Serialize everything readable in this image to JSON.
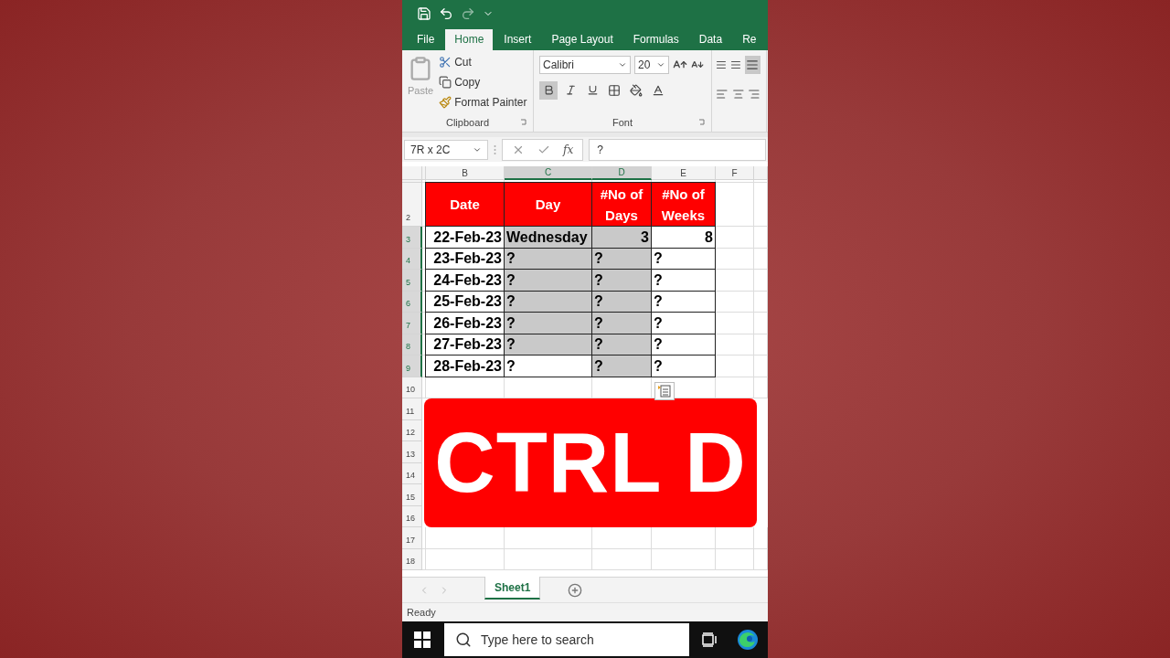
{
  "ribbon_tabs": [
    {
      "label": "File",
      "selected": false
    },
    {
      "label": "Home",
      "selected": true
    },
    {
      "label": "Insert",
      "selected": false
    },
    {
      "label": "Page Layout",
      "selected": false
    },
    {
      "label": "Formulas",
      "selected": false
    },
    {
      "label": "Data",
      "selected": false
    },
    {
      "label": "Re",
      "selected": false
    }
  ],
  "clipboard": {
    "paste": "Paste",
    "cut": "Cut",
    "copy": "Copy",
    "format_painter": "Format Painter",
    "group_label": "Clipboard"
  },
  "font": {
    "name": "Calibri",
    "size": "20",
    "bold": true,
    "italic": false,
    "underline": false,
    "group_label": "Font"
  },
  "formula_bar": {
    "name_box": "7R x 2C",
    "function_label": "fx",
    "value": "?"
  },
  "columns": [
    {
      "label": "B",
      "selected": false
    },
    {
      "label": "C",
      "selected": true
    },
    {
      "label": "D",
      "selected": true
    },
    {
      "label": "E",
      "selected": false
    },
    {
      "label": "F",
      "selected": false
    }
  ],
  "header_row": {
    "row": "2",
    "cells": [
      "Date",
      "Day",
      "#No of Days",
      "#No of Weeks"
    ]
  },
  "rows": [
    {
      "row": "3",
      "selected": true,
      "cells": [
        {
          "text": "22-Feb-23",
          "kind": "date",
          "selected": false
        },
        {
          "text": "Wednesday",
          "kind": "text",
          "selected": true
        },
        {
          "text": "3",
          "kind": "number",
          "selected": true
        },
        {
          "text": "8",
          "kind": "number",
          "selected": false
        }
      ]
    },
    {
      "row": "4",
      "selected": true,
      "cells": [
        {
          "text": "23-Feb-23",
          "kind": "date",
          "selected": false
        },
        {
          "text": "?",
          "kind": "text",
          "selected": true
        },
        {
          "text": "?",
          "kind": "text",
          "selected": true
        },
        {
          "text": "?",
          "kind": "text",
          "selected": false
        }
      ]
    },
    {
      "row": "5",
      "selected": true,
      "cells": [
        {
          "text": "24-Feb-23",
          "kind": "date",
          "selected": false
        },
        {
          "text": "?",
          "kind": "text",
          "selected": true
        },
        {
          "text": "?",
          "kind": "text",
          "selected": true
        },
        {
          "text": "?",
          "kind": "text",
          "selected": false
        }
      ]
    },
    {
      "row": "6",
      "selected": true,
      "cells": [
        {
          "text": "25-Feb-23",
          "kind": "date",
          "selected": false
        },
        {
          "text": "?",
          "kind": "text",
          "selected": true
        },
        {
          "text": "?",
          "kind": "text",
          "selected": true
        },
        {
          "text": "?",
          "kind": "text",
          "selected": false
        }
      ]
    },
    {
      "row": "7",
      "selected": true,
      "cells": [
        {
          "text": "26-Feb-23",
          "kind": "date",
          "selected": false
        },
        {
          "text": "?",
          "kind": "text",
          "selected": true
        },
        {
          "text": "?",
          "kind": "text",
          "selected": true
        },
        {
          "text": "?",
          "kind": "text",
          "selected": false
        }
      ]
    },
    {
      "row": "8",
      "selected": true,
      "cells": [
        {
          "text": "27-Feb-23",
          "kind": "date",
          "selected": false
        },
        {
          "text": "?",
          "kind": "text",
          "selected": true
        },
        {
          "text": "?",
          "kind": "text",
          "selected": true
        },
        {
          "text": "?",
          "kind": "text",
          "selected": false
        }
      ]
    },
    {
      "row": "9",
      "selected": true,
      "cells": [
        {
          "text": "28-Feb-23",
          "kind": "date",
          "selected": false
        },
        {
          "text": "?",
          "kind": "text",
          "selected": false
        },
        {
          "text": "?",
          "kind": "text",
          "selected": true
        },
        {
          "text": "?",
          "kind": "text",
          "selected": false
        }
      ]
    }
  ],
  "empty_rows": [
    "10",
    "11",
    "12",
    "13",
    "14",
    "15",
    "16",
    "17",
    "18"
  ],
  "overlay_caption": "CTRL D",
  "sheet_tabs": [
    {
      "label": "Sheet1",
      "selected": true
    }
  ],
  "status": "Ready",
  "taskbar": {
    "search_placeholder": "Type here to search"
  }
}
